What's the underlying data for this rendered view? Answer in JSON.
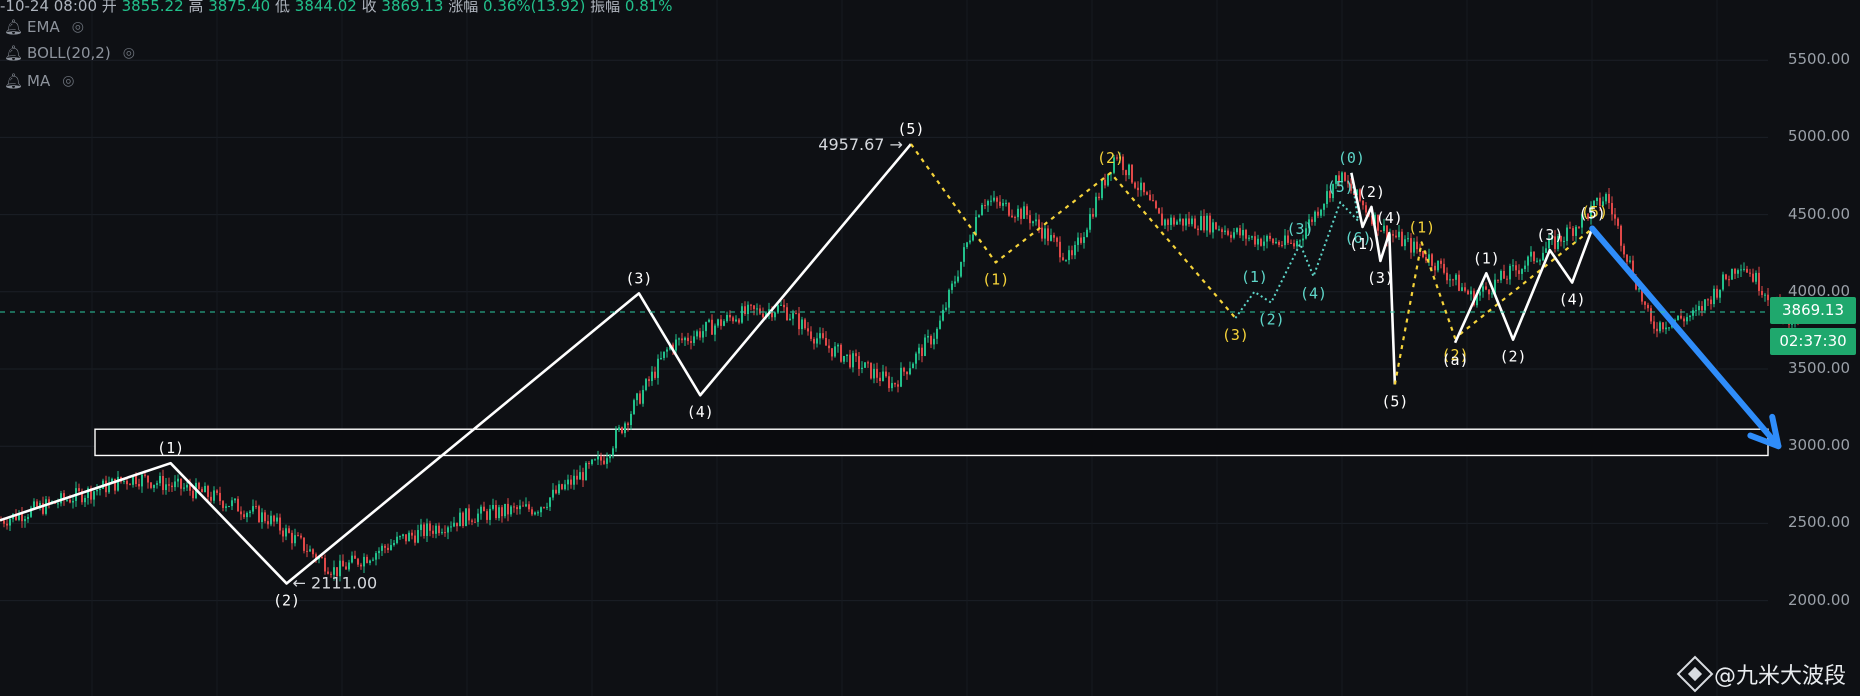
{
  "header": {
    "prefix": "-10-24 08:00",
    "open_label": "开",
    "open": "3855.22",
    "high_label": "高",
    "high": "3875.40",
    "low_label": "低",
    "low": "3844.02",
    "close_label": "收",
    "close": "3869.13",
    "change_label": "涨幅",
    "change": "0.36%(13.92)",
    "amp_label": "振幅",
    "amp": "0.81%"
  },
  "indicators": [
    {
      "name": "EMA",
      "icon": "bell-icon",
      "toggle_icon": "eye-off-icon"
    },
    {
      "name": "BOLL(20,2)",
      "icon": "bell-icon",
      "toggle_icon": "eye-off-icon"
    },
    {
      "name": "MA",
      "icon": "bell-icon",
      "toggle_icon": "eye-off-icon"
    }
  ],
  "colors": {
    "up": "#22c08b",
    "down": "#e04848",
    "white_wave": "#ffffff",
    "yellow_wave": "#f5d33a",
    "cyan_wave": "#5ed6c9",
    "arrow": "#2f8dfa"
  },
  "price_tag": {
    "last": "3869.13",
    "countdown": "02:37:30"
  },
  "watermark": {
    "text": "@九米大波段",
    "icon": "exchange-logo-icon"
  },
  "chart_data": {
    "type": "line",
    "title": "",
    "xlabel": "",
    "ylabel": "",
    "ylim": [
      1650,
      5600
    ],
    "y_ticks": [
      "5500.00",
      "5000.00",
      "4500.00",
      "4000.00",
      "3500.00",
      "3000.00",
      "2500.00",
      "2000.00"
    ],
    "y_tick_values": [
      5500,
      5000,
      4500,
      4000,
      3500,
      3000,
      2500,
      2000
    ],
    "x": [
      0,
      60,
      120,
      180,
      240,
      300,
      360,
      420,
      480,
      540,
      600,
      660,
      700,
      740,
      800,
      840,
      880,
      920,
      960,
      1000,
      1040,
      1080,
      1120,
      1160,
      1200,
      1240,
      1280,
      1320,
      1360,
      1400,
      1440,
      1480,
      1520,
      1560,
      1600,
      1640,
      1680
    ],
    "close_series": [
      2520,
      2660,
      2800,
      2700,
      2530,
      2190,
      2400,
      2550,
      2600,
      2920,
      3650,
      3850,
      3900,
      3650,
      3400,
      3750,
      4600,
      4500,
      4200,
      4900,
      4460,
      4450,
      4350,
      4300,
      4750,
      4400,
      4230,
      3960,
      4150,
      4350,
      4620,
      3780,
      3850,
      4200,
      3850,
      3750,
      3870
    ],
    "current_price": 3869.13,
    "support_zone": [
      2940,
      3110
    ],
    "annotations": {
      "high_price": "4957.67",
      "low_price": "2111.00"
    },
    "white_wave": [
      {
        "x": 0,
        "y": 2520
      },
      {
        "x": 153,
        "y": 2890,
        "label": "(1)"
      },
      {
        "x": 257,
        "y": 2111,
        "label": "(2)"
      },
      {
        "x": 573,
        "y": 3990,
        "label": "(3)"
      },
      {
        "x": 628,
        "y": 3330,
        "label": "(4)"
      },
      {
        "x": 817,
        "y": 4957,
        "label": "(5)"
      }
    ],
    "yellow_wave": [
      {
        "x": 817,
        "y": 4957
      },
      {
        "x": 893,
        "y": 4190,
        "label": "(1)"
      },
      {
        "x": 996,
        "y": 4770,
        "label": "(2)"
      },
      {
        "x": 1108,
        "y": 3830,
        "label": "(3)"
      }
    ],
    "cyan_wave": [
      {
        "x": 1108,
        "y": 3830
      },
      {
        "x": 1125,
        "y": 4000,
        "label": "(1)"
      },
      {
        "x": 1140,
        "y": 3930,
        "label": "(2)"
      },
      {
        "x": 1166,
        "y": 4310,
        "label": "(3)"
      },
      {
        "x": 1178,
        "y": 4100,
        "label": "(4)"
      },
      {
        "x": 1202,
        "y": 4580,
        "label": "(5)"
      },
      {
        "x": 1218,
        "y": 4460,
        "label": "(6)"
      },
      {
        "x": 1212,
        "y": 4770,
        "label": "(0)"
      }
    ],
    "white_wave2": [
      {
        "x": 1212,
        "y": 4770
      },
      {
        "x": 1222,
        "y": 4420,
        "label": "(1)"
      },
      {
        "x": 1230,
        "y": 4550,
        "label": "(2)"
      },
      {
        "x": 1238,
        "y": 4200,
        "label": "(3)"
      },
      {
        "x": 1246,
        "y": 4380,
        "label": "(4)"
      },
      {
        "x": 1251,
        "y": 3400,
        "label": "(5)"
      }
    ],
    "yellow_wave2": [
      {
        "x": 1251,
        "y": 3400
      },
      {
        "x": 1275,
        "y": 4320,
        "label": "(1)"
      },
      {
        "x": 1305,
        "y": 3700,
        "label": "(2)"
      },
      {
        "x": 1430,
        "y": 4420,
        "label": "(5)"
      }
    ],
    "white_wave3": [
      {
        "x": 1305,
        "y": 3670,
        "label": "(a)"
      },
      {
        "x": 1333,
        "y": 4120,
        "label": "(1)"
      },
      {
        "x": 1357,
        "y": 3690,
        "label": "(2)"
      },
      {
        "x": 1390,
        "y": 4270,
        "label": "(3)"
      },
      {
        "x": 1410,
        "y": 4060,
        "label": "(4)"
      },
      {
        "x": 1428,
        "y": 4410,
        "label": "(5)"
      }
    ],
    "forecast_arrow": {
      "from": {
        "x": 1428,
        "y": 4410
      },
      "to": {
        "x": 1595,
        "y": 3000
      }
    }
  }
}
